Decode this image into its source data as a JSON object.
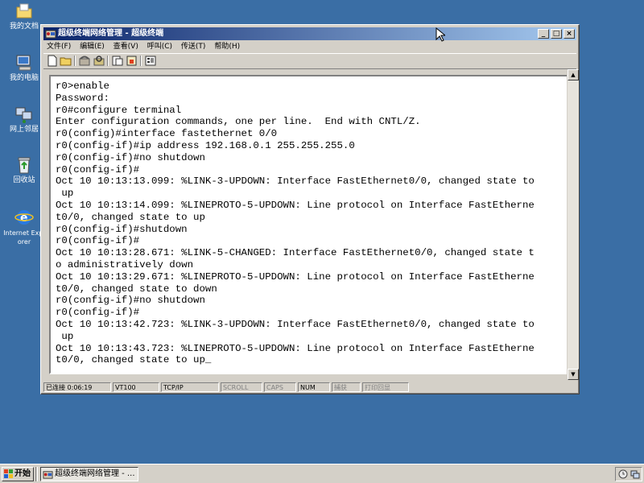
{
  "desktop": {
    "icons": [
      {
        "label": "我的文档",
        "icon": "folder-icon"
      },
      {
        "label": "我的电脑",
        "icon": "computer-icon"
      },
      {
        "label": "网上邻居",
        "icon": "network-icon"
      },
      {
        "label": "回收站",
        "icon": "recycle-bin-icon"
      },
      {
        "label": "Internet Explorer",
        "icon": "ie-icon"
      }
    ],
    "background": "#3a6ea5"
  },
  "window": {
    "title": "超级终端网络管理 - 超级终端",
    "menu": [
      "文件(F)",
      "编辑(E)",
      "查看(V)",
      "呼叫(C)",
      "传送(T)",
      "帮助(H)"
    ],
    "controls": {
      "minimize": "_",
      "maximize": "□",
      "close": "×"
    },
    "toolbar": [
      "new-icon",
      "open-icon",
      "phone-icon",
      "disconnect-icon",
      "send-icon",
      "receive-icon",
      "properties-icon"
    ]
  },
  "terminal": {
    "lines": [
      "r0>enable",
      "Password:",
      "r0#configure terminal",
      "Enter configuration commands, one per line.  End with CNTL/Z.",
      "r0(config)#interface fastethernet 0/0",
      "r0(config-if)#ip address 192.168.0.1 255.255.255.0",
      "r0(config-if)#no shutdown",
      "r0(config-if)#",
      "Oct 10 10:13:13.099: %LINK-3-UPDOWN: Interface FastEthernet0/0, changed state to",
      " up",
      "Oct 10 10:13:14.099: %LINEPROTO-5-UPDOWN: Line protocol on Interface FastEtherne",
      "t0/0, changed state to up",
      "r0(config-if)#shutdown",
      "r0(config-if)#",
      "Oct 10 10:13:28.671: %LINK-5-CHANGED: Interface FastEthernet0/0, changed state t",
      "o administratively down",
      "Oct 10 10:13:29.671: %LINEPROTO-5-UPDOWN: Line protocol on Interface FastEtherne",
      "t0/0, changed state to down",
      "r0(config-if)#no shutdown",
      "r0(config-if)#",
      "Oct 10 10:13:42.723: %LINK-3-UPDOWN: Interface FastEthernet0/0, changed state to",
      " up",
      "Oct 10 10:13:43.723: %LINEPROTO-5-UPDOWN: Line protocol on Interface FastEtherne",
      "t0/0, changed state to up_"
    ]
  },
  "statusbar": {
    "connected": "已连接 0:06:19",
    "emulation": "VT100",
    "protocol": "TCP/IP",
    "scroll": "SCROLL",
    "caps": "CAPS",
    "num": "NUM",
    "capture": "捕获",
    "print_echo": "打印回显"
  },
  "taskbar": {
    "start": "开始",
    "task_item": "超级终端网络管理 - ..."
  }
}
